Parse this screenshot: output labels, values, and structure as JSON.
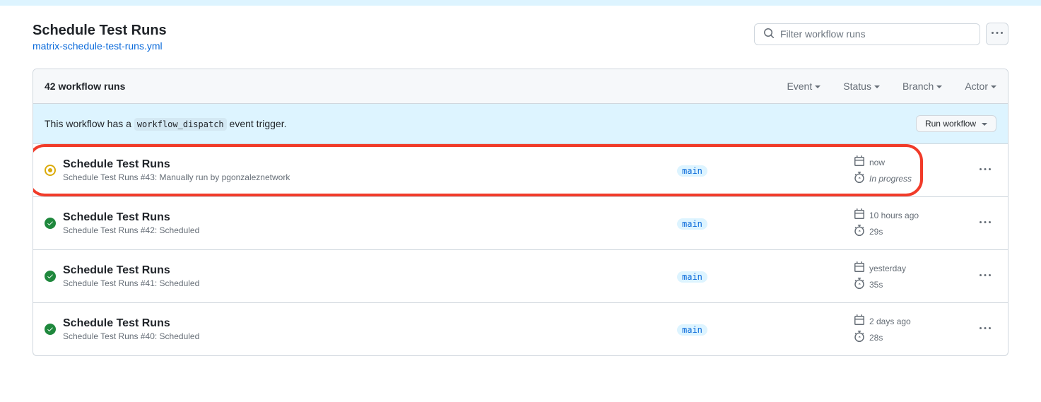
{
  "page_title": "Schedule Test Runs",
  "yml_file": "matrix-schedule-test-runs.yml",
  "search_placeholder": "Filter workflow runs",
  "runs_count_label": "42 workflow runs",
  "filters": {
    "event": "Event",
    "status": "Status",
    "branch": "Branch",
    "actor": "Actor"
  },
  "dispatch": {
    "prefix": "This workflow has a ",
    "code": "workflow_dispatch",
    "suffix": " event trigger.",
    "button": "Run workflow"
  },
  "runs": [
    {
      "status": "in_progress",
      "title": "Schedule Test Runs",
      "sub_prefix": "Schedule Test Runs ",
      "sub_rest": "#43: Manually run by pgonzaleznetwork",
      "branch": "main",
      "time": "now",
      "duration": "In progress",
      "duration_italic": true,
      "highlighted": true
    },
    {
      "status": "success",
      "title": "Schedule Test Runs",
      "sub_prefix": "Schedule Test Runs ",
      "sub_rest": "#42: Scheduled",
      "branch": "main",
      "time": "10 hours ago",
      "duration": "29s",
      "duration_italic": false,
      "highlighted": false
    },
    {
      "status": "success",
      "title": "Schedule Test Runs",
      "sub_prefix": "Schedule Test Runs ",
      "sub_rest": "#41: Scheduled",
      "branch": "main",
      "time": "yesterday",
      "duration": "35s",
      "duration_italic": false,
      "highlighted": false
    },
    {
      "status": "success",
      "title": "Schedule Test Runs",
      "sub_prefix": "Schedule Test Runs ",
      "sub_rest": "#40: Scheduled",
      "branch": "main",
      "time": "2 days ago",
      "duration": "28s",
      "duration_italic": false,
      "highlighted": false
    }
  ]
}
